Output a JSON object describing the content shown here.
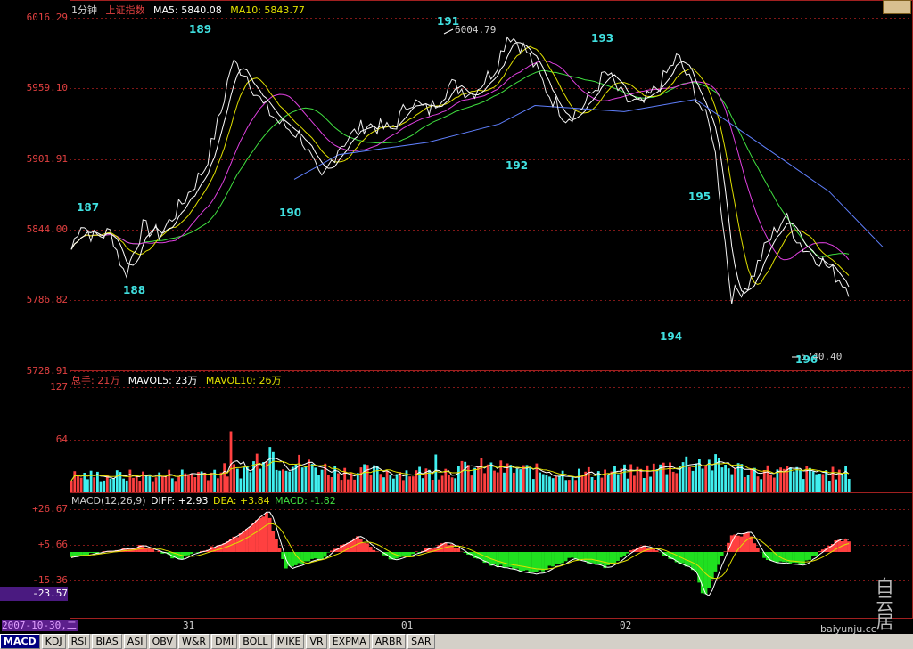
{
  "price_panel": {
    "period": "1分钟",
    "index_name": "上证指数",
    "ma5_label": "MA5: 5840.08",
    "ma10_label": "MA10: 5843.77",
    "y_ticks": [
      "6016.29",
      "5959.10",
      "5901.91",
      "5844.00",
      "5786.82",
      "5728.91"
    ],
    "high_label": "6004.79",
    "low_label": "5740.40",
    "colors": {
      "ma5": "#ffffff",
      "ma10": "#e0e000",
      "ma20": "#e040e0",
      "ma30": "#40e040",
      "ma60": "#6080ff"
    }
  },
  "waves": [
    "187",
    "188",
    "189",
    "190",
    "191",
    "192",
    "193",
    "194",
    "195",
    "196"
  ],
  "volume_panel": {
    "total_label": "总手: 21万",
    "mavol5_label": "MAVOL5: 23万",
    "mavol10_label": "MAVOL10: 26万",
    "y_ticks": [
      "127",
      "64"
    ],
    "colors": {
      "up": "#ff4040",
      "down": "#40f0f0"
    }
  },
  "macd_panel": {
    "title": "MACD(12,26,9)",
    "diff_label": "DIFF: +2.93",
    "dea_label": "DEA: +3.84",
    "macd_label": "MACD: -1.82",
    "y_ticks": [
      "+26.67",
      "+5.66",
      "-15.36"
    ],
    "current_value": "-23.57",
    "colors": {
      "pos": "#ff4040",
      "neg": "#20e020"
    }
  },
  "x_axis": {
    "labels": [
      "31",
      "01",
      "02"
    ],
    "date_badge": "2007-10-30,二"
  },
  "tabs": [
    {
      "label": "MACD",
      "active": true
    },
    {
      "label": "KDJ"
    },
    {
      "label": "RSI"
    },
    {
      "label": "BIAS"
    },
    {
      "label": "ASI"
    },
    {
      "label": "OBV"
    },
    {
      "label": "W&R"
    },
    {
      "label": "DMI"
    },
    {
      "label": "BOLL"
    },
    {
      "label": "MIKE"
    },
    {
      "label": "VR"
    },
    {
      "label": "EXPMA"
    },
    {
      "label": "ARBR"
    },
    {
      "label": "SAR"
    }
  ],
  "watermark": {
    "chars": "白云居",
    "url": "baiyunju.cc"
  },
  "chart_data": {
    "type": "line",
    "x_labels": [
      "31",
      "01",
      "02"
    ],
    "price_anchors": [
      [
        0,
        5828
      ],
      [
        10,
        5850
      ],
      [
        25,
        5838
      ],
      [
        45,
        5842
      ],
      [
        60,
        5806
      ],
      [
        80,
        5846
      ],
      [
        100,
        5840
      ],
      [
        130,
        5872
      ],
      [
        150,
        5895
      ],
      [
        168,
        5940
      ],
      [
        180,
        5980
      ],
      [
        195,
        5972
      ],
      [
        215,
        5945
      ],
      [
        235,
        5930
      ],
      [
        258,
        5920
      ],
      [
        280,
        5882
      ],
      [
        300,
        5912
      ],
      [
        330,
        5930
      ],
      [
        360,
        5925
      ],
      [
        380,
        5950
      ],
      [
        400,
        5940
      ],
      [
        425,
        5962
      ],
      [
        450,
        5955
      ],
      [
        475,
        5975
      ],
      [
        490,
        6004
      ],
      [
        510,
        5990
      ],
      [
        535,
        5955
      ],
      [
        555,
        5935
      ],
      [
        575,
        5945
      ],
      [
        600,
        5972
      ],
      [
        620,
        5950
      ],
      [
        640,
        5945
      ],
      [
        660,
        5962
      ],
      [
        680,
        5985
      ],
      [
        700,
        5955
      ],
      [
        720,
        5920
      ],
      [
        740,
        5790
      ],
      [
        760,
        5800
      ],
      [
        780,
        5832
      ],
      [
        800,
        5855
      ],
      [
        820,
        5830
      ],
      [
        840,
        5820
      ],
      [
        860,
        5805
      ],
      [
        880,
        5790
      ],
      [
        895,
        5742
      ],
      [
        905,
        5780
      ],
      [
        920,
        5800
      ],
      [
        935,
        5800
      ],
      [
        950,
        5790
      ]
    ],
    "ma_slow_anchors": [
      [
        250,
        5885
      ],
      [
        300,
        5905
      ],
      [
        400,
        5915
      ],
      [
        480,
        5930
      ],
      [
        520,
        5945
      ],
      [
        620,
        5940
      ],
      [
        700,
        5950
      ],
      [
        780,
        5910
      ],
      [
        850,
        5875
      ],
      [
        910,
        5830
      ]
    ],
    "volume_level": [
      [
        0,
        20
      ],
      [
        100,
        20
      ],
      [
        200,
        28
      ],
      [
        220,
        60
      ],
      [
        230,
        40
      ],
      [
        300,
        25
      ],
      [
        400,
        24
      ],
      [
        460,
        30
      ],
      [
        560,
        22
      ],
      [
        640,
        25
      ],
      [
        700,
        38
      ],
      [
        760,
        26
      ],
      [
        860,
        22
      ],
      [
        900,
        28
      ],
      [
        950,
        40
      ]
    ],
    "macd_hist": [
      [
        0,
        -3
      ],
      [
        80,
        4
      ],
      [
        120,
        -5
      ],
      [
        180,
        8
      ],
      [
        220,
        26
      ],
      [
        240,
        -10
      ],
      [
        280,
        -4
      ],
      [
        320,
        10
      ],
      [
        360,
        -6
      ],
      [
        420,
        6
      ],
      [
        470,
        -8
      ],
      [
        520,
        -14
      ],
      [
        560,
        -4
      ],
      [
        600,
        -10
      ],
      [
        640,
        5
      ],
      [
        700,
        -12
      ],
      [
        710,
        -30
      ],
      [
        740,
        10
      ],
      [
        760,
        12
      ],
      [
        780,
        -6
      ],
      [
        820,
        -8
      ],
      [
        860,
        8
      ],
      [
        900,
        6
      ],
      [
        930,
        -6
      ],
      [
        950,
        -3
      ]
    ]
  }
}
